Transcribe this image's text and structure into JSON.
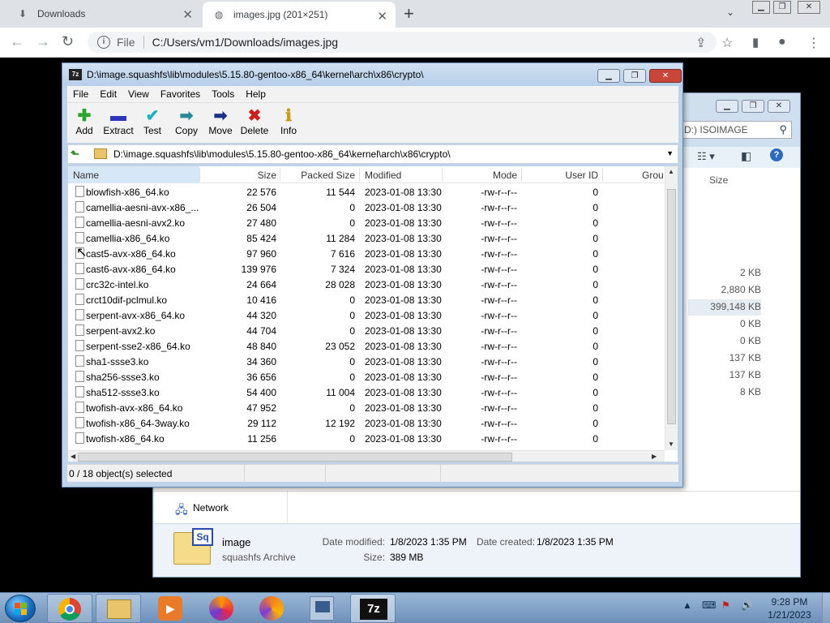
{
  "browser": {
    "tabs": [
      {
        "label": "Downloads",
        "active": false
      },
      {
        "label": "images.jpg (201×251)",
        "active": true
      }
    ],
    "omnibox": {
      "scheme_label": "File",
      "url": "C:/Users/vm1/Downloads/images.jpg"
    }
  },
  "explorer": {
    "search_placeholder": "D:) ISOIMAGE",
    "size_header": "Size",
    "sizes": [
      "2 KB",
      "2,880 KB",
      "399,148 KB",
      "0 KB",
      "0 KB",
      "137 KB",
      "137 KB",
      "8 KB"
    ],
    "nav_network": "Network",
    "details": {
      "file_name": "image",
      "file_type": "squashfs Archive",
      "modified_label": "Date modified:",
      "modified_value": "1/8/2023 1:35 PM",
      "created_label": "Date created:",
      "created_value": "1/8/2023 1:35 PM",
      "size_label": "Size:",
      "size_value": "389 MB"
    }
  },
  "sevenzip": {
    "title": "D:\\image.squashfs\\lib\\modules\\5.15.80-gentoo-x86_64\\kernel\\arch\\x86\\crypto\\",
    "menu": [
      "File",
      "Edit",
      "View",
      "Favorites",
      "Tools",
      "Help"
    ],
    "toolbar": {
      "add": "Add",
      "extract": "Extract",
      "test": "Test",
      "copy": "Copy",
      "move": "Move",
      "delete": "Delete",
      "info": "Info"
    },
    "path": "D:\\image.squashfs\\lib\\modules\\5.15.80-gentoo-x86_64\\kernel\\arch\\x86\\crypto\\",
    "columns": {
      "name": "Name",
      "size": "Size",
      "packed": "Packed Size",
      "modified": "Modified",
      "mode": "Mode",
      "user_id": "User ID",
      "group": "Grou"
    },
    "files": [
      {
        "name": "blowfish-x86_64.ko",
        "size": "22 576",
        "packed": "11 544",
        "modified": "2023-01-08 13:30",
        "mode": "-rw-r--r--",
        "uid": "0"
      },
      {
        "name": "camellia-aesni-avx-x86_...",
        "size": "26 504",
        "packed": "0",
        "modified": "2023-01-08 13:30",
        "mode": "-rw-r--r--",
        "uid": "0"
      },
      {
        "name": "camellia-aesni-avx2.ko",
        "size": "27 480",
        "packed": "0",
        "modified": "2023-01-08 13:30",
        "mode": "-rw-r--r--",
        "uid": "0"
      },
      {
        "name": "camellia-x86_64.ko",
        "size": "85 424",
        "packed": "11 284",
        "modified": "2023-01-08 13:30",
        "mode": "-rw-r--r--",
        "uid": "0"
      },
      {
        "name": "cast5-avx-x86_64.ko",
        "size": "97 960",
        "packed": "7 616",
        "modified": "2023-01-08 13:30",
        "mode": "-rw-r--r--",
        "uid": "0"
      },
      {
        "name": "cast6-avx-x86_64.ko",
        "size": "139 976",
        "packed": "7 324",
        "modified": "2023-01-08 13:30",
        "mode": "-rw-r--r--",
        "uid": "0"
      },
      {
        "name": "crc32c-intel.ko",
        "size": "24 664",
        "packed": "28 028",
        "modified": "2023-01-08 13:30",
        "mode": "-rw-r--r--",
        "uid": "0"
      },
      {
        "name": "crct10dif-pclmul.ko",
        "size": "10 416",
        "packed": "0",
        "modified": "2023-01-08 13:30",
        "mode": "-rw-r--r--",
        "uid": "0"
      },
      {
        "name": "serpent-avx-x86_64.ko",
        "size": "44 320",
        "packed": "0",
        "modified": "2023-01-08 13:30",
        "mode": "-rw-r--r--",
        "uid": "0"
      },
      {
        "name": "serpent-avx2.ko",
        "size": "44 704",
        "packed": "0",
        "modified": "2023-01-08 13:30",
        "mode": "-rw-r--r--",
        "uid": "0"
      },
      {
        "name": "serpent-sse2-x86_64.ko",
        "size": "48 840",
        "packed": "23 052",
        "modified": "2023-01-08 13:30",
        "mode": "-rw-r--r--",
        "uid": "0"
      },
      {
        "name": "sha1-ssse3.ko",
        "size": "34 360",
        "packed": "0",
        "modified": "2023-01-08 13:30",
        "mode": "-rw-r--r--",
        "uid": "0"
      },
      {
        "name": "sha256-ssse3.ko",
        "size": "36 656",
        "packed": "0",
        "modified": "2023-01-08 13:30",
        "mode": "-rw-r--r--",
        "uid": "0"
      },
      {
        "name": "sha512-ssse3.ko",
        "size": "54 400",
        "packed": "11 004",
        "modified": "2023-01-08 13:30",
        "mode": "-rw-r--r--",
        "uid": "0"
      },
      {
        "name": "twofish-avx-x86_64.ko",
        "size": "47 952",
        "packed": "0",
        "modified": "2023-01-08 13:30",
        "mode": "-rw-r--r--",
        "uid": "0"
      },
      {
        "name": "twofish-x86_64-3way.ko",
        "size": "29 112",
        "packed": "12 192",
        "modified": "2023-01-08 13:30",
        "mode": "-rw-r--r--",
        "uid": "0"
      },
      {
        "name": "twofish-x86_64.ko",
        "size": "11 256",
        "packed": "0",
        "modified": "2023-01-08 13:30",
        "mode": "-rw-r--r--",
        "uid": "0"
      }
    ],
    "status": "0 / 18 object(s) selected"
  },
  "taskbar": {
    "icons": [
      "start-orb",
      "chrome-icon",
      "file-explorer-icon",
      "media-player-icon",
      "firefox-icon",
      "brave-icon",
      "network-app-icon",
      "7zip-icon"
    ],
    "clock_time": "9:28 PM",
    "clock_date": "1/21/2023"
  }
}
